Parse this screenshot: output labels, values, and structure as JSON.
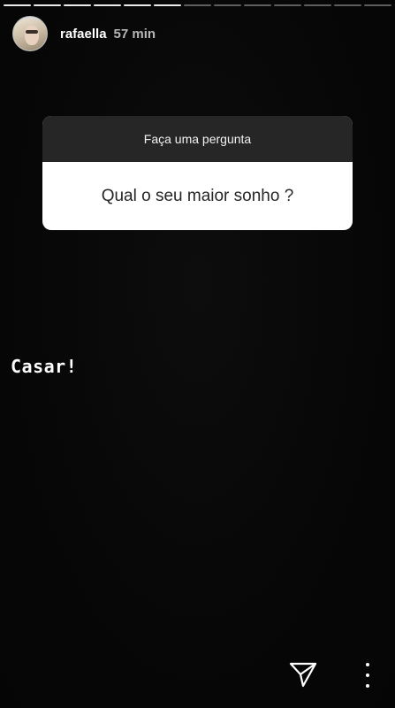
{
  "story": {
    "segments_total": 13,
    "segments_viewed": 6
  },
  "header": {
    "username": "rafaella",
    "time_ago": "57 min"
  },
  "question_sticker": {
    "prompt": "Faça uma pergunta",
    "question": "Qual o seu maior sonho ?"
  },
  "answer": {
    "text": "Casar!"
  },
  "footer": {
    "send_icon": "send-icon",
    "more_icon": "more-options-icon"
  }
}
